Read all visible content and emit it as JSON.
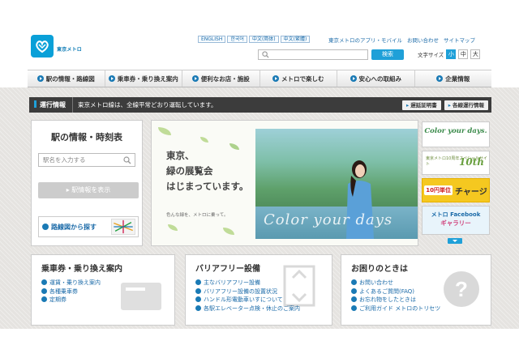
{
  "header": {
    "logo_text": "東京メトロ",
    "languages": [
      "ENGLISH",
      "한국어",
      "中文(简体)",
      "中文(繁體)"
    ],
    "top_links": [
      "東京メトロのアプリ・モバイル",
      "お問い合わせ",
      "サイトマップ"
    ],
    "search_button": "検索",
    "font_size_label": "文字サイズ",
    "font_sizes": [
      "小",
      "中",
      "大"
    ]
  },
  "nav": {
    "items": [
      "駅の情報・路線図",
      "乗車券・乗り換え案内",
      "便利なお店・施設",
      "メトロで楽しむ",
      "安心への取組み",
      "企業情報"
    ]
  },
  "status": {
    "label": "運行情報",
    "message": "東京メトロ線は、全線平常どおり運転しています。",
    "btn_delay": "遅延証明書",
    "btn_lines": "各線運行情報"
  },
  "station": {
    "title": "駅の情報・時刻表",
    "input_placeholder": "駅名を入力する",
    "show_button": "駅情報を表示",
    "map_link": "路線図から探す"
  },
  "hero": {
    "copy_lines": [
      "東京、",
      "緑の展覧会",
      "はじまっています。"
    ],
    "small_text": "色んな緑を、メトロに乗って。",
    "script_text": "Color your days"
  },
  "banners": {
    "b1_title": "Color your days.",
    "b1_sub": "",
    "b2_text": "東京メトロ10周年スペシャルサイト",
    "b2_mark": "10th",
    "b3_badge": "10円単位",
    "b3_text": "チャージ",
    "b4_brand": "メトロ Facebook",
    "b4_sub": "ギャラリー"
  },
  "boxes": {
    "tickets": {
      "title": "乗車券・乗り換え案内",
      "items": [
        "運賃・乗り換え案内",
        "各種乗車券",
        "定期券"
      ]
    },
    "barrierfree": {
      "title": "バリアフリー設備",
      "items": [
        "主なバリアフリー設備",
        "バリアフリー設備の設置状況",
        "ハンドル形電動車いすについて",
        "各駅エレベーター点検・休止のご案内"
      ]
    },
    "help": {
      "title": "お困りのときは",
      "items": [
        "お問い合わせ",
        "よくあるご質問(FAQ)",
        "お忘れ物をしたときは",
        "ご利用ガイド メトロのトリセツ"
      ]
    }
  },
  "colors": {
    "brand": "#0aa0d8",
    "accent": "#1a7ab5",
    "status_bg": "#3c3c3c",
    "charge_yellow": "#f5c820"
  }
}
